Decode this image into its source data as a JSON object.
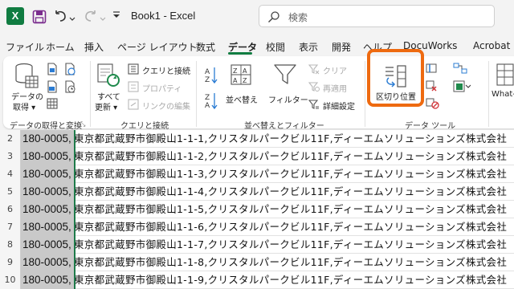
{
  "titlebar": {
    "app_logo": "X",
    "doc_title": "Book1  -  Excel",
    "search_placeholder": "検索"
  },
  "tabs": [
    {
      "label": "ファイル",
      "active": false
    },
    {
      "label": "ホーム",
      "active": false
    },
    {
      "label": "挿入",
      "active": false
    },
    {
      "label": "ページ レイアウト",
      "active": false
    },
    {
      "label": "数式",
      "active": false
    },
    {
      "label": "データ",
      "active": true
    },
    {
      "label": "校閲",
      "active": false
    },
    {
      "label": "表示",
      "active": false
    },
    {
      "label": "開発",
      "active": false
    },
    {
      "label": "ヘルプ",
      "active": false
    },
    {
      "label": "DocuWorks",
      "active": false
    },
    {
      "label": "Acrobat",
      "active": false
    }
  ],
  "ribbon": {
    "get_data": {
      "line1": "データの",
      "line2": "取得 ▾"
    },
    "refresh_all": {
      "line1": "すべて",
      "line2": "更新 ▾"
    },
    "queries_connections": "クエリと接続",
    "properties": "プロパティ",
    "edit_links": "リンクの編集",
    "sort": "並べ替え",
    "filter": "フィルター",
    "clear": "クリア",
    "reapply": "再適用",
    "advanced": "詳細設定",
    "text_to_columns": "区切り位置",
    "what_if": "What-If",
    "groups": {
      "get_transform": "データの取得と変換",
      "queries": "クエリと接続",
      "sort_filter": "並べ替えとフィルター",
      "data_tools": "データ ツール"
    }
  },
  "sheet": {
    "rows": [
      {
        "num": "2",
        "a": "180-0005,",
        "b": "東京都武蔵野市御殿山1-1-1,クリスタルパークビル11F,ディーエムソリューションズ株式会社"
      },
      {
        "num": "3",
        "a": "180-0005,",
        "b": "東京都武蔵野市御殿山1-1-2,クリスタルパークビル11F,ディーエムソリューションズ株式会社"
      },
      {
        "num": "4",
        "a": "180-0005,",
        "b": "東京都武蔵野市御殿山1-1-3,クリスタルパークビル11F,ディーエムソリューションズ株式会社"
      },
      {
        "num": "5",
        "a": "180-0005,",
        "b": "東京都武蔵野市御殿山1-1-4,クリスタルパークビル11F,ディーエムソリューションズ株式会社"
      },
      {
        "num": "6",
        "a": "180-0005,",
        "b": "東京都武蔵野市御殿山1-1-5,クリスタルパークビル11F,ディーエムソリューションズ株式会社"
      },
      {
        "num": "7",
        "a": "180-0005,",
        "b": "東京都武蔵野市御殿山1-1-6,クリスタルパークビル11F,ディーエムソリューションズ株式会社"
      },
      {
        "num": "8",
        "a": "180-0005,",
        "b": "東京都武蔵野市御殿山1-1-7,クリスタルパークビル11F,ディーエムソリューションズ株式会社"
      },
      {
        "num": "9",
        "a": "180-0005,",
        "b": "東京都武蔵野市御殿山1-1-8,クリスタルパークビル11F,ディーエムソリューションズ株式会社"
      },
      {
        "num": "10",
        "a": "180-0005,",
        "b": "東京都武蔵野市御殿山1-1-9,クリスタルパークビル11F,ディーエムソリューションズ株式会社"
      }
    ]
  },
  "colors": {
    "accent": "#107c41",
    "highlight": "#ee6a10",
    "column_a_fill": "#c9c9c9",
    "split_line": "#1e7b4a"
  },
  "icons": {
    "save": "save-icon",
    "undo": "undo-icon",
    "redo": "redo-icon",
    "search": "search-icon",
    "filter": "funnel-icon",
    "text_to_columns": "text-to-columns-icon"
  }
}
